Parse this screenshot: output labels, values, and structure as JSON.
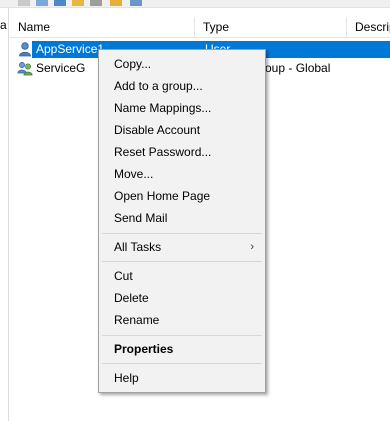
{
  "left_pane": {
    "label": "a"
  },
  "list": {
    "columns": [
      "Name",
      "Type",
      "Descrip"
    ],
    "rows": [
      {
        "name": "AppService1",
        "type": "User",
        "selected": true
      },
      {
        "name": "ServiceG",
        "type": "Security Group - Global",
        "selected": false
      }
    ]
  },
  "context_menu": {
    "items": [
      {
        "label": "Copy..."
      },
      {
        "label": "Add to a group..."
      },
      {
        "label": "Name Mappings..."
      },
      {
        "label": "Disable Account"
      },
      {
        "label": "Reset Password..."
      },
      {
        "label": "Move..."
      },
      {
        "label": "Open Home Page"
      },
      {
        "label": "Send Mail"
      },
      {
        "label": "All Tasks",
        "submenu": true
      },
      {
        "label": "Cut"
      },
      {
        "label": "Delete"
      },
      {
        "label": "Rename"
      },
      {
        "label": "Properties",
        "highlighted": true
      },
      {
        "label": "Help"
      }
    ]
  },
  "colors": {
    "selection": "#0078d7",
    "menu_bg": "#f2f2f2",
    "highlight": "#f5f500"
  }
}
